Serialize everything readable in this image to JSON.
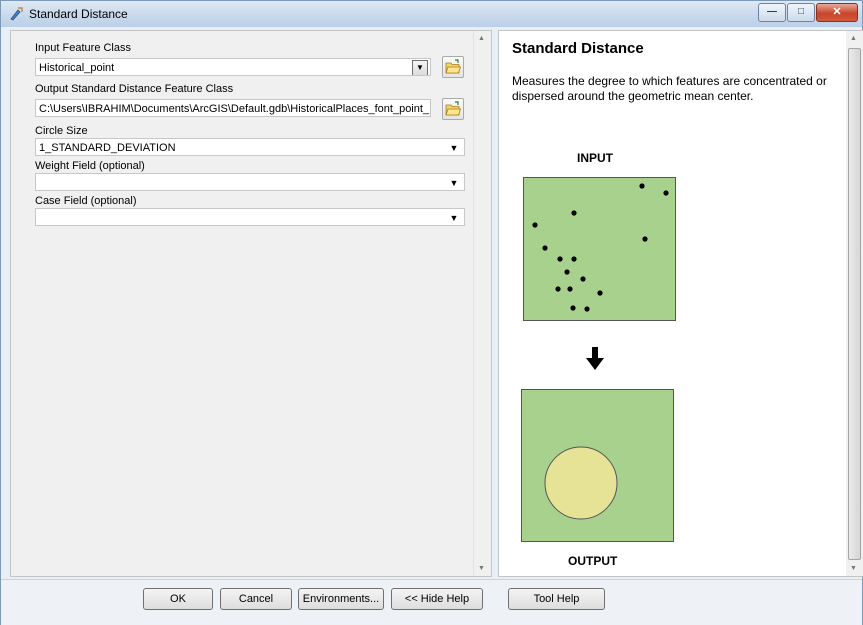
{
  "window": {
    "title": "Standard Distance",
    "icon": "tool-icon"
  },
  "form": {
    "input_feature_class": {
      "label": "Input Feature Class",
      "value": "Historical_point"
    },
    "output_feature_class": {
      "label": "Output Standard Distance Feature Class",
      "value": "C:\\Users\\IBRAHIM\\Documents\\ArcGIS\\Default.gdb\\HistoricalPlaces_font_point_"
    },
    "circle_size": {
      "label": "Circle Size",
      "value": "1_STANDARD_DEVIATION"
    },
    "weight_field": {
      "label": "Weight Field (optional)",
      "value": ""
    },
    "case_field": {
      "label": "Case Field (optional)",
      "value": ""
    }
  },
  "help": {
    "title": "Standard Distance",
    "description": "Measures the degree to which features are concentrated or dispersed around the geometric mean center.",
    "input_label": "INPUT",
    "output_label": "OUTPUT"
  },
  "buttons": {
    "ok": "OK",
    "cancel": "Cancel",
    "environments": "Environments...",
    "hide_help": "<< Hide Help",
    "tool_help": "Tool Help"
  },
  "colors": {
    "diagram_fill": "#a8d18d",
    "circle_fill": "#e6e397",
    "window_accent": "#bcd0e8"
  }
}
